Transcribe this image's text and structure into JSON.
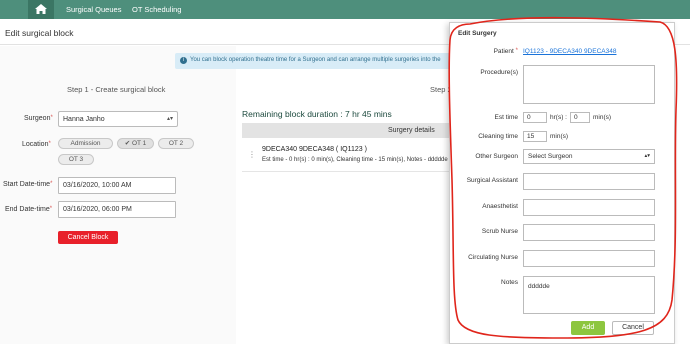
{
  "nav": {
    "links": [
      "Surgical Queues",
      "OT Scheduling"
    ]
  },
  "page": {
    "title": "Edit surgical block"
  },
  "info": {
    "text": "You can block operation theatre time for a Surgeon and can arrange multiple surgeries into the"
  },
  "step1": {
    "heading": "Step 1 - Create surgical block",
    "surgeon_label": "Surgeon",
    "surgeon_value": "Hanna Janho",
    "location_label": "Location",
    "locations": [
      "Admission",
      "OT 1",
      "OT 2",
      "OT 3"
    ],
    "start_label": "Start Date-time",
    "start_value": "03/16/2020, 10:00 AM",
    "end_label": "End Date-time",
    "end_value": "03/16/2020, 06:00 PM",
    "cancel_block": "Cancel Block"
  },
  "step2": {
    "heading": "Step 2",
    "remaining": "Remaining block duration : 7 hr 45 mins",
    "details_header": "Surgery details",
    "row_name": "9DECA340 9DECA348 ( IQ1123 )",
    "row_detail": "Est time - 0 hr(s) : 0 min(s), Cleaning time - 15 min(s), Notes - ddddde"
  },
  "modal": {
    "title": "Edit Surgery",
    "patient_label": "Patient",
    "patient_value": "IQ1123 - 9DECA340 9DECA348",
    "procedure_label": "Procedure(s)",
    "est_label": "Est time",
    "est_hr": "0",
    "hr_unit": "hr(s) :",
    "est_min": "0",
    "min_unit": "min(s)",
    "cleaning_label": "Cleaning time",
    "cleaning_value": "15",
    "cleaning_unit": "min(s)",
    "other_surgeon_label": "Other Surgeon",
    "other_surgeon_value": "Select Surgeon",
    "assistant_label": "Surgical Assistant",
    "anaesthetist_label": "Anaesthetist",
    "scrub_label": "Scrub Nurse",
    "circulating_label": "Circulating Nurse",
    "notes_label": "Notes",
    "notes_value": "ddddde",
    "add": "Add",
    "cancel": "Cancel"
  },
  "colors": {
    "nav": "#4e8f7c",
    "accent_red": "#e8202a",
    "add_green": "#8dc63f",
    "annotation": "#e0251b"
  }
}
